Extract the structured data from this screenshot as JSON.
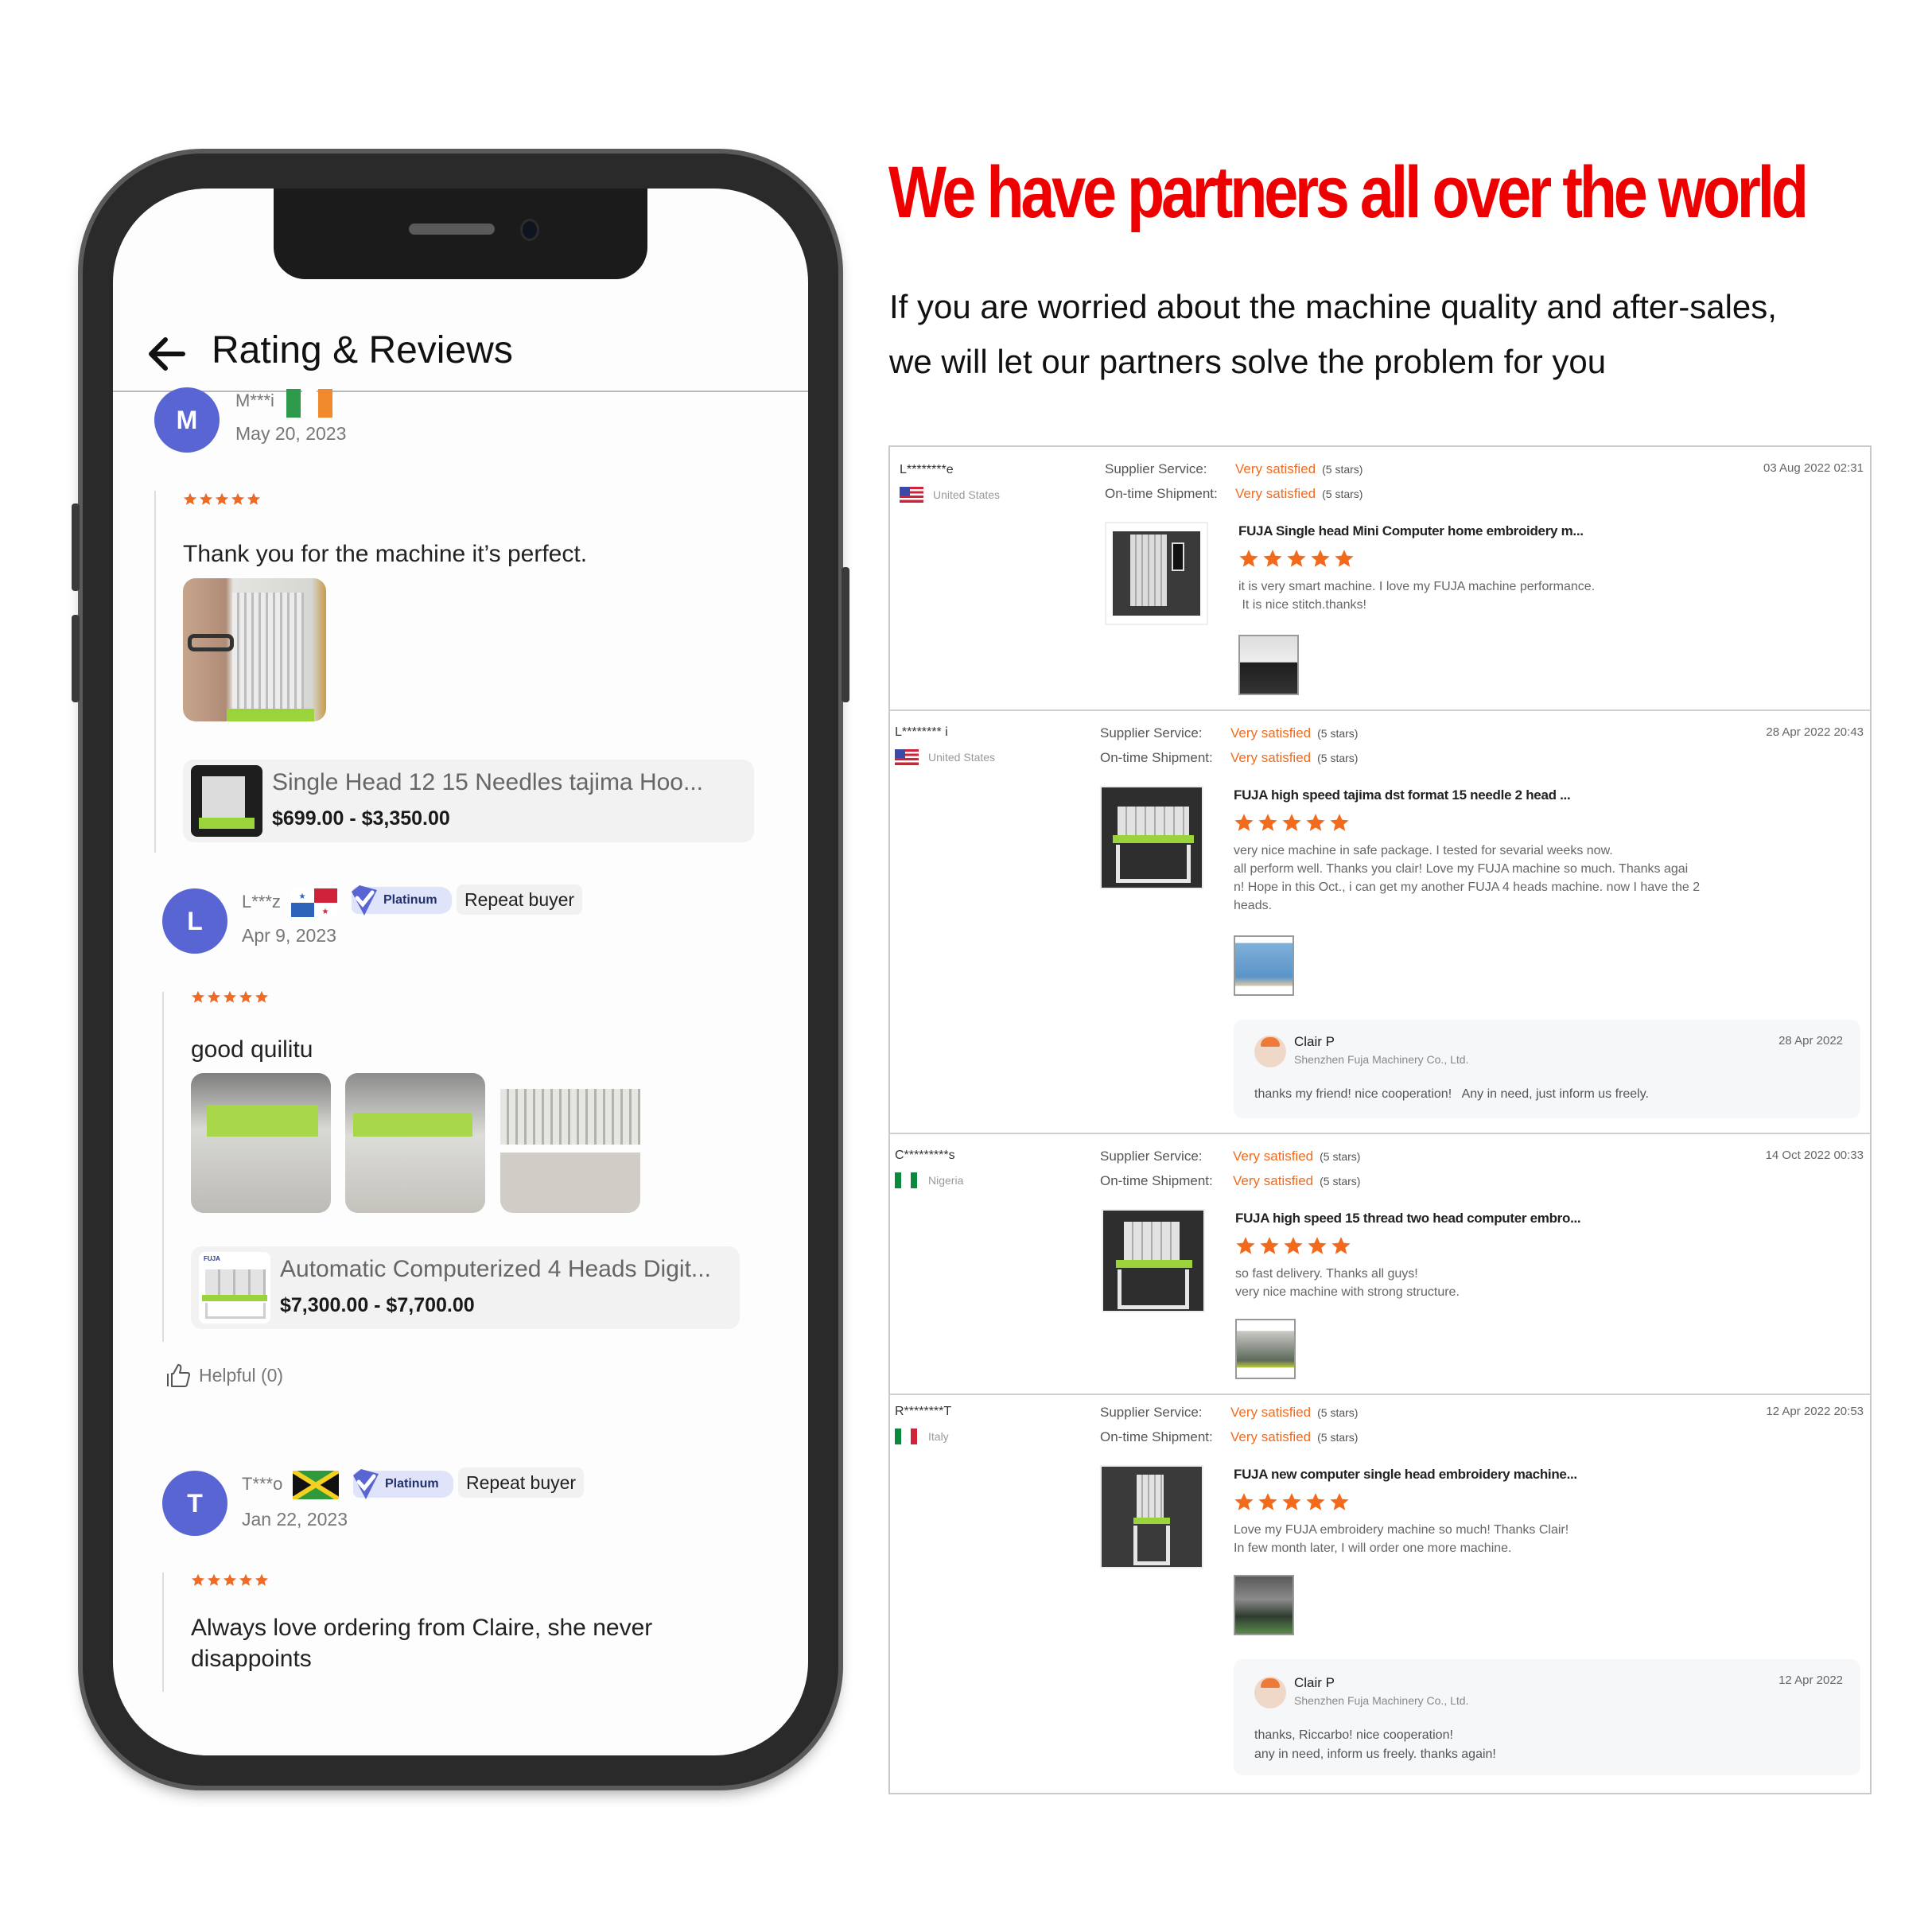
{
  "phone": {
    "header": {
      "title": "Rating & Reviews",
      "back_icon": "arrow-left-icon"
    },
    "reviews": [
      {
        "initial": "M",
        "user": "M***i",
        "flag": "ireland-flag",
        "date": "May 20, 2023",
        "rating": 5,
        "text": "Thank you for the machine it’s perfect.",
        "photos": 1,
        "product": {
          "name": "Single Head 12 15 Needles  tajima Hoo...",
          "price": "$699.00 - $3,350.00"
        }
      },
      {
        "initial": "L",
        "user": "L***z",
        "flag": "panama-flag",
        "date": "Apr 9, 2023",
        "badge": "Platinum",
        "tag": "Repeat buyer",
        "rating": 5,
        "text": "good quilitu",
        "photos": 3,
        "product": {
          "name": "Automatic Computerized 4 Heads Digit...",
          "price": "$7,300.00 - $7,700.00"
        },
        "helpful": "Helpful (0)"
      },
      {
        "initial": "T",
        "user": "T***o",
        "flag": "jamaica-flag",
        "date": "Jan 22, 2023",
        "badge": "Platinum",
        "tag": "Repeat buyer",
        "rating": 5,
        "text": "Always love ordering from Claire, she never disappoints"
      }
    ]
  },
  "headline": "We have partners all over the world",
  "subtext": [
    "If you are worried about the machine quality and after-sales,",
    "we will let our partners solve the problem for you"
  ],
  "panel": {
    "labels": {
      "supplier": "Supplier Service:",
      "shipment": "On-time Shipment:"
    },
    "satisfaction": "Very satisfied",
    "stars_note": "(5 stars)",
    "colors": {
      "accent": "#f26b1d",
      "headline": "#ee0000",
      "avatar": "#5865d2"
    },
    "reviews": [
      {
        "buyer": "L********e",
        "country": "United States",
        "timestamp": "03 Aug 2022 02:31",
        "product": "FUJA Single head Mini Computer home embroidery m...",
        "rating": 5,
        "text": [
          "it is very smart machine. I love my FUJA machine performance.",
          " It is nice stitch.thanks!"
        ]
      },
      {
        "buyer": "L******** i",
        "country": "United States",
        "timestamp": "28 Apr 2022 20:43",
        "product": "FUJA high speed tajima dst format 15 needle 2 head ...",
        "rating": 5,
        "text": [
          "very nice machine in safe package. I tested for sevarial weeks now.",
          "all perform well. Thanks you clair! Love my FUJA machine so much. Thanks agai",
          "n! Hope in this Oct., i can get my another FUJA 4 heads machine. now I have the 2",
          "heads."
        ],
        "reply": {
          "name": "Clair P",
          "company": "Shenzhen Fuja Machinery Co., Ltd.",
          "date": "28 Apr 2022",
          "text": [
            "thanks my friend! nice cooperation!   Any in need, just inform us freely."
          ]
        }
      },
      {
        "buyer": "C*********s",
        "country": "Nigeria",
        "timestamp": "14 Oct 2022 00:33",
        "product": "FUJA high speed 15 thread two head computer embro...",
        "rating": 5,
        "text": [
          "so fast delivery. Thanks all guys!",
          "very nice machine with strong structure."
        ]
      },
      {
        "buyer": "R********T",
        "country": "Italy",
        "timestamp": "12 Apr 2022 20:53",
        "product": "FUJA new computer single head embroidery machine...",
        "rating": 5,
        "text": [
          "Love my FUJA embroidery machine so much! Thanks Clair!",
          "In few month later, I will order one more machine."
        ],
        "reply": {
          "name": "Clair P",
          "company": "Shenzhen Fuja Machinery Co., Ltd.",
          "date": "12 Apr 2022",
          "text": [
            "thanks, Riccarbo! nice cooperation!",
            "any in need, inform us freely. thanks again!"
          ]
        }
      }
    ]
  }
}
